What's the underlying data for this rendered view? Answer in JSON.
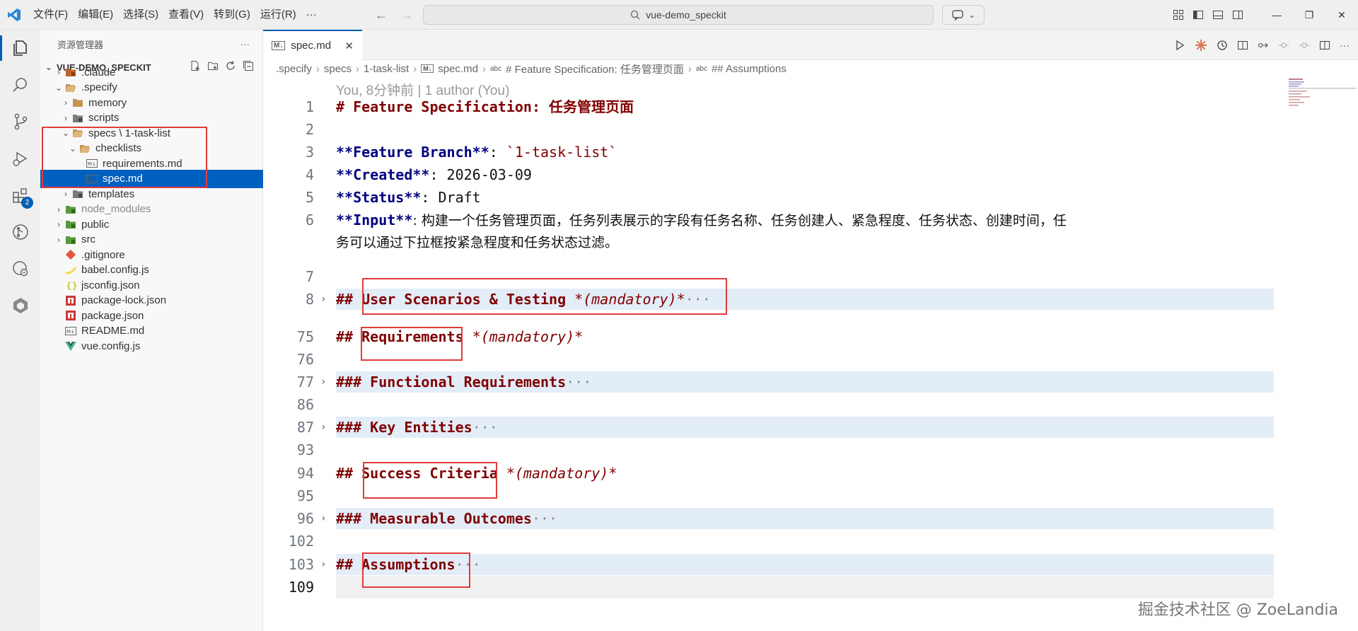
{
  "titlebar": {
    "menu": [
      "文件(F)",
      "编辑(E)",
      "选择(S)",
      "查看(V)",
      "转到(G)",
      "运行(R)",
      "···"
    ],
    "search_text": "vue-demo_speckit"
  },
  "activitybar": {
    "items": [
      "explorer-icon",
      "search-icon",
      "source-control-icon",
      "run-debug-icon",
      "extensions-icon",
      "git-graph-icon",
      "remote-explorer-icon",
      "speckit-icon"
    ],
    "extensions_badge": "2"
  },
  "sidebar": {
    "title": "资源管理器",
    "more": "···",
    "folder": "VUE-DEMO_SPECKIT",
    "tree": [
      {
        "label": ".claude",
        "chev": "›",
        "kind": "folder-red"
      },
      {
        "label": ".specify",
        "chev": "⌄",
        "kind": "folder-open"
      },
      {
        "label": "memory",
        "chev": "›",
        "kind": "folder"
      },
      {
        "label": "scripts",
        "chev": "›",
        "kind": "folder-dark"
      },
      {
        "label": "specs \\ 1-task-list",
        "chev": "⌄",
        "kind": "folder-open"
      },
      {
        "label": "checklists",
        "chev": "⌄",
        "kind": "folder-open"
      },
      {
        "label": "requirements.md",
        "chev": "",
        "kind": "md"
      },
      {
        "label": "spec.md",
        "chev": "",
        "kind": "md"
      },
      {
        "label": "templates",
        "chev": "›",
        "kind": "folder-dark"
      },
      {
        "label": "node_modules",
        "chev": "›",
        "kind": "folder-green"
      },
      {
        "label": "public",
        "chev": "›",
        "kind": "folder-green"
      },
      {
        "label": "src",
        "chev": "›",
        "kind": "folder-green"
      },
      {
        "label": ".gitignore",
        "chev": "",
        "kind": "git"
      },
      {
        "label": "babel.config.js",
        "chev": "",
        "kind": "babel"
      },
      {
        "label": "jsconfig.json",
        "chev": "",
        "kind": "js"
      },
      {
        "label": "package-lock.json",
        "chev": "",
        "kind": "npm"
      },
      {
        "label": "package.json",
        "chev": "",
        "kind": "npm"
      },
      {
        "label": "README.md",
        "chev": "",
        "kind": "md"
      },
      {
        "label": "vue.config.js",
        "chev": "",
        "kind": "vue"
      }
    ]
  },
  "tab": {
    "label": "spec.md",
    "icon": "M↓",
    "close": "✕"
  },
  "breadcrumb": [
    ".specify",
    "specs",
    "1-task-list",
    "spec.md",
    "# Feature Specification: 任务管理页面",
    "## Assumptions"
  ],
  "editor": {
    "blame": "You, 8分钟前 | 1 author (You)",
    "lines": {
      "l1": {
        "n": "1",
        "h": "# Feature Specification: ",
        "t": "任务管理页面"
      },
      "l2": {
        "n": "2"
      },
      "l3": {
        "n": "3",
        "k": "**Feature Branch**",
        "p": ": ",
        "c": "`1-task-list`"
      },
      "l4": {
        "n": "4",
        "k": "**Created**",
        "p": ": 2026-03-09"
      },
      "l5": {
        "n": "5",
        "k": "**Status**",
        "p": ": Draft"
      },
      "l6": {
        "n": "6",
        "k": "**Input**",
        "p": ": 构建一个任务管理页面，任务列表展示的字段有任务名称、任务创建人、紧急程度、任务状态、创建时间，任",
        "p2": "务可以通过下拉框按紧急程度和任务状态过滤。"
      },
      "l7": {
        "n": "7"
      },
      "l8": {
        "n": "8",
        "hm": "## ",
        "h": "User Scenarios & Testing",
        "i": " *(mandatory)*",
        "e": "···"
      },
      "l75": {
        "n": "75",
        "hm": "## ",
        "h": "Requirements",
        "i": " *(mandatory)*"
      },
      "l76": {
        "n": "76"
      },
      "l77": {
        "n": "77",
        "hm": "### ",
        "h": "Functional Requirements",
        "e": "···"
      },
      "l86": {
        "n": "86"
      },
      "l87": {
        "n": "87",
        "hm": "### ",
        "h": "Key Entities",
        "e": "···"
      },
      "l93": {
        "n": "93"
      },
      "l94": {
        "n": "94",
        "hm": "## ",
        "h": "Success Criteria",
        "i": " *(mandatory)*"
      },
      "l95": {
        "n": "95"
      },
      "l96": {
        "n": "96",
        "hm": "### ",
        "h": "Measurable Outcomes",
        "e": "···"
      },
      "l102": {
        "n": "102"
      },
      "l103": {
        "n": "103",
        "hm": "## ",
        "h": "Assumptions",
        "e": "···"
      },
      "l109": {
        "n": "109"
      }
    }
  },
  "watermark": "掘金技术社区 @ ZoeLandia",
  "colors": {
    "accent": "#005fb8",
    "selection": "#0060c0",
    "heading": "#800000",
    "keyword": "#000080",
    "annotation": "#e03c3c",
    "fold_bg": "#e3edf8"
  }
}
